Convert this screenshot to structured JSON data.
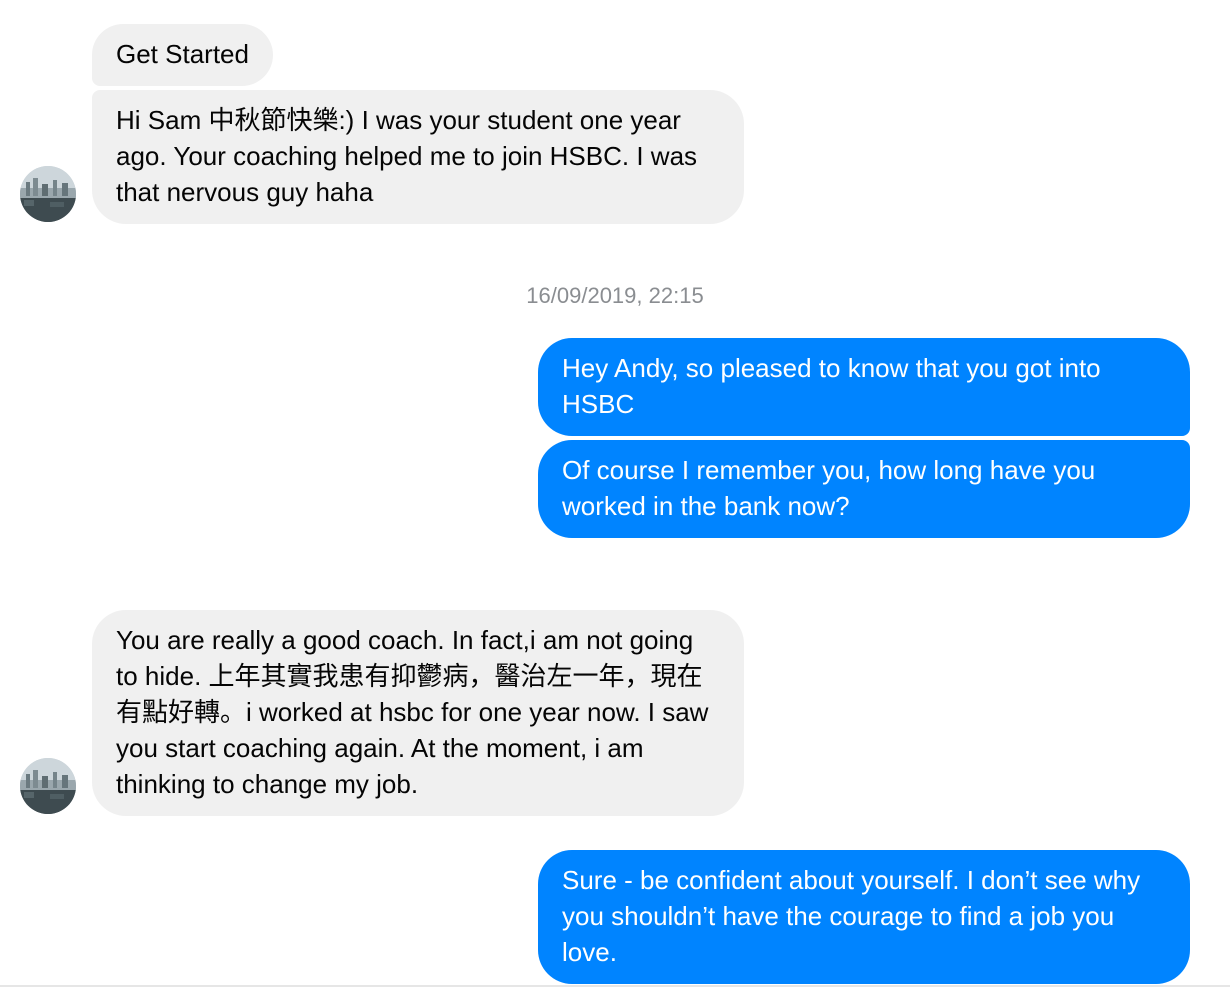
{
  "conversation": {
    "messages": [
      {
        "sender": "contact",
        "text": "Get Started"
      },
      {
        "sender": "contact",
        "text": "Hi Sam 中秋節快樂:) I was your student one year ago. Your coaching helped me to join HSBC. I was that nervous guy haha"
      },
      {
        "sender": "me",
        "text": "Hey Andy, so pleased to know that you got into HSBC"
      },
      {
        "sender": "me",
        "text": "Of course I remember you, how long have you worked in the bank now?"
      },
      {
        "sender": "contact",
        "text": "You are really a good coach. In fact,i am not going to hide. 上年其實我患有抑鬱病，醫治左一年，現在有點好轉。i worked at hsbc for one year now. I saw you start coaching again. At the moment, i am thinking to change my job."
      },
      {
        "sender": "me",
        "text": "Sure - be confident about yourself. I don’t see why you shouldn’t have the courage to find a job you love."
      }
    ],
    "timestamp": "16/09/2019, 22:15"
  },
  "colors": {
    "incoming_bubble": "#f0f0f0",
    "outgoing_bubble": "#0084ff",
    "timestamp_text": "#8a8d91"
  },
  "icons": {
    "contact_avatar": "avatar-photo"
  }
}
